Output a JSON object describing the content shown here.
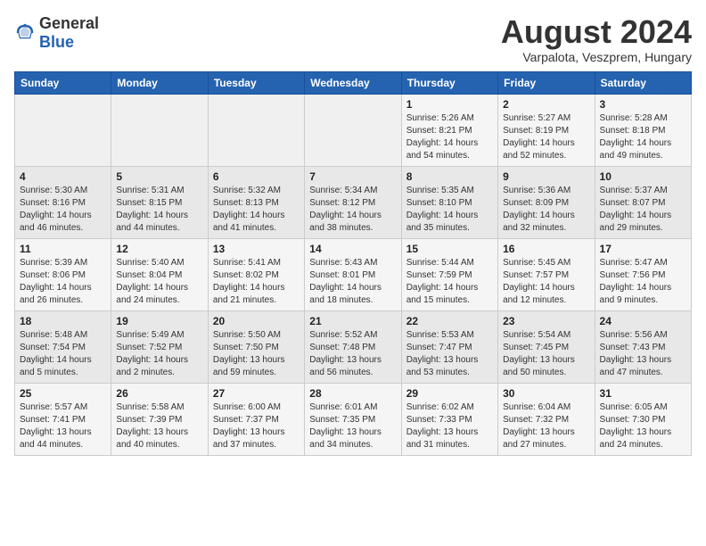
{
  "header": {
    "logo_general": "General",
    "logo_blue": "Blue",
    "month_year": "August 2024",
    "location": "Varpalota, Veszprem, Hungary"
  },
  "weekdays": [
    "Sunday",
    "Monday",
    "Tuesday",
    "Wednesday",
    "Thursday",
    "Friday",
    "Saturday"
  ],
  "weeks": [
    [
      {
        "day": "",
        "info": ""
      },
      {
        "day": "",
        "info": ""
      },
      {
        "day": "",
        "info": ""
      },
      {
        "day": "",
        "info": ""
      },
      {
        "day": "1",
        "info": "Sunrise: 5:26 AM\nSunset: 8:21 PM\nDaylight: 14 hours\nand 54 minutes."
      },
      {
        "day": "2",
        "info": "Sunrise: 5:27 AM\nSunset: 8:19 PM\nDaylight: 14 hours\nand 52 minutes."
      },
      {
        "day": "3",
        "info": "Sunrise: 5:28 AM\nSunset: 8:18 PM\nDaylight: 14 hours\nand 49 minutes."
      }
    ],
    [
      {
        "day": "4",
        "info": "Sunrise: 5:30 AM\nSunset: 8:16 PM\nDaylight: 14 hours\nand 46 minutes."
      },
      {
        "day": "5",
        "info": "Sunrise: 5:31 AM\nSunset: 8:15 PM\nDaylight: 14 hours\nand 44 minutes."
      },
      {
        "day": "6",
        "info": "Sunrise: 5:32 AM\nSunset: 8:13 PM\nDaylight: 14 hours\nand 41 minutes."
      },
      {
        "day": "7",
        "info": "Sunrise: 5:34 AM\nSunset: 8:12 PM\nDaylight: 14 hours\nand 38 minutes."
      },
      {
        "day": "8",
        "info": "Sunrise: 5:35 AM\nSunset: 8:10 PM\nDaylight: 14 hours\nand 35 minutes."
      },
      {
        "day": "9",
        "info": "Sunrise: 5:36 AM\nSunset: 8:09 PM\nDaylight: 14 hours\nand 32 minutes."
      },
      {
        "day": "10",
        "info": "Sunrise: 5:37 AM\nSunset: 8:07 PM\nDaylight: 14 hours\nand 29 minutes."
      }
    ],
    [
      {
        "day": "11",
        "info": "Sunrise: 5:39 AM\nSunset: 8:06 PM\nDaylight: 14 hours\nand 26 minutes."
      },
      {
        "day": "12",
        "info": "Sunrise: 5:40 AM\nSunset: 8:04 PM\nDaylight: 14 hours\nand 24 minutes."
      },
      {
        "day": "13",
        "info": "Sunrise: 5:41 AM\nSunset: 8:02 PM\nDaylight: 14 hours\nand 21 minutes."
      },
      {
        "day": "14",
        "info": "Sunrise: 5:43 AM\nSunset: 8:01 PM\nDaylight: 14 hours\nand 18 minutes."
      },
      {
        "day": "15",
        "info": "Sunrise: 5:44 AM\nSunset: 7:59 PM\nDaylight: 14 hours\nand 15 minutes."
      },
      {
        "day": "16",
        "info": "Sunrise: 5:45 AM\nSunset: 7:57 PM\nDaylight: 14 hours\nand 12 minutes."
      },
      {
        "day": "17",
        "info": "Sunrise: 5:47 AM\nSunset: 7:56 PM\nDaylight: 14 hours\nand 9 minutes."
      }
    ],
    [
      {
        "day": "18",
        "info": "Sunrise: 5:48 AM\nSunset: 7:54 PM\nDaylight: 14 hours\nand 5 minutes."
      },
      {
        "day": "19",
        "info": "Sunrise: 5:49 AM\nSunset: 7:52 PM\nDaylight: 14 hours\nand 2 minutes."
      },
      {
        "day": "20",
        "info": "Sunrise: 5:50 AM\nSunset: 7:50 PM\nDaylight: 13 hours\nand 59 minutes."
      },
      {
        "day": "21",
        "info": "Sunrise: 5:52 AM\nSunset: 7:48 PM\nDaylight: 13 hours\nand 56 minutes."
      },
      {
        "day": "22",
        "info": "Sunrise: 5:53 AM\nSunset: 7:47 PM\nDaylight: 13 hours\nand 53 minutes."
      },
      {
        "day": "23",
        "info": "Sunrise: 5:54 AM\nSunset: 7:45 PM\nDaylight: 13 hours\nand 50 minutes."
      },
      {
        "day": "24",
        "info": "Sunrise: 5:56 AM\nSunset: 7:43 PM\nDaylight: 13 hours\nand 47 minutes."
      }
    ],
    [
      {
        "day": "25",
        "info": "Sunrise: 5:57 AM\nSunset: 7:41 PM\nDaylight: 13 hours\nand 44 minutes."
      },
      {
        "day": "26",
        "info": "Sunrise: 5:58 AM\nSunset: 7:39 PM\nDaylight: 13 hours\nand 40 minutes."
      },
      {
        "day": "27",
        "info": "Sunrise: 6:00 AM\nSunset: 7:37 PM\nDaylight: 13 hours\nand 37 minutes."
      },
      {
        "day": "28",
        "info": "Sunrise: 6:01 AM\nSunset: 7:35 PM\nDaylight: 13 hours\nand 34 minutes."
      },
      {
        "day": "29",
        "info": "Sunrise: 6:02 AM\nSunset: 7:33 PM\nDaylight: 13 hours\nand 31 minutes."
      },
      {
        "day": "30",
        "info": "Sunrise: 6:04 AM\nSunset: 7:32 PM\nDaylight: 13 hours\nand 27 minutes."
      },
      {
        "day": "31",
        "info": "Sunrise: 6:05 AM\nSunset: 7:30 PM\nDaylight: 13 hours\nand 24 minutes."
      }
    ]
  ]
}
